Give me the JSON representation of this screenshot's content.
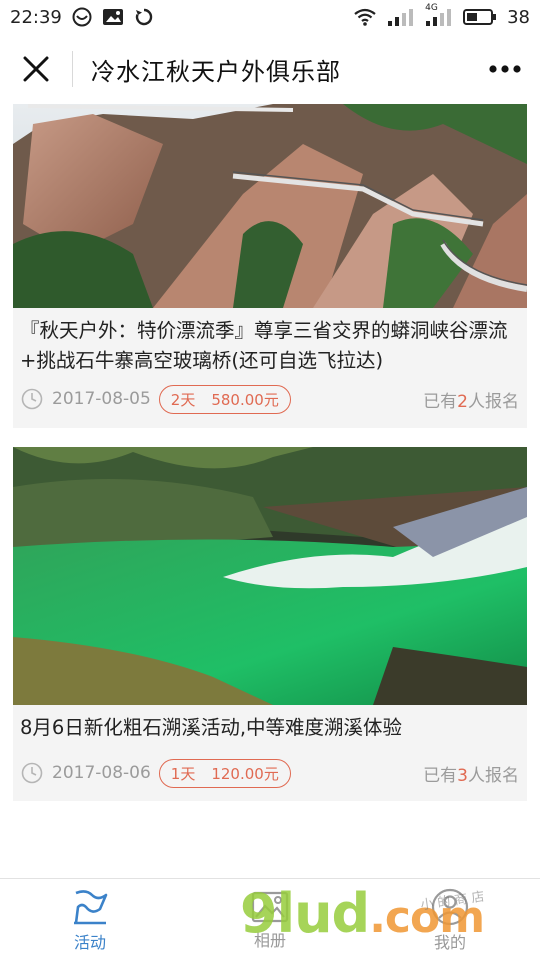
{
  "status": {
    "time": "22:39",
    "battery": "38",
    "network": "4G"
  },
  "header": {
    "title": "冷水江秋天户外俱乐部"
  },
  "cards": [
    {
      "title": "『秋天户外：特价漂流季』尊享三省交界的蟒洞峡谷漂流+挑战石牛寨高空玻璃桥(还可自选飞拉达)",
      "date": "2017-08-05",
      "days": "2天",
      "price": "580.00元",
      "signup_prefix": "已有",
      "signup_count": "2",
      "signup_suffix": "人报名"
    },
    {
      "title": "8月6日新化粗石溯溪活动,中等难度溯溪体验",
      "date": "2017-08-06",
      "days": "1天",
      "price": "120.00元",
      "signup_prefix": "已有",
      "signup_count": "3",
      "signup_suffix": "人报名"
    }
  ],
  "tabs": [
    {
      "label": "活动",
      "icon": "flag-icon",
      "active": true
    },
    {
      "label": "相册",
      "icon": "image-icon",
      "active": false
    },
    {
      "label": "我的",
      "icon": "user-icon",
      "active": false
    }
  ],
  "watermark": {
    "brand": "9lud",
    "suffix": ".com",
    "small": "小 的 商 店"
  },
  "colors": {
    "accent": "#e06a52",
    "tab_active": "#3b82c9",
    "meta_text": "#9b9b9b"
  }
}
